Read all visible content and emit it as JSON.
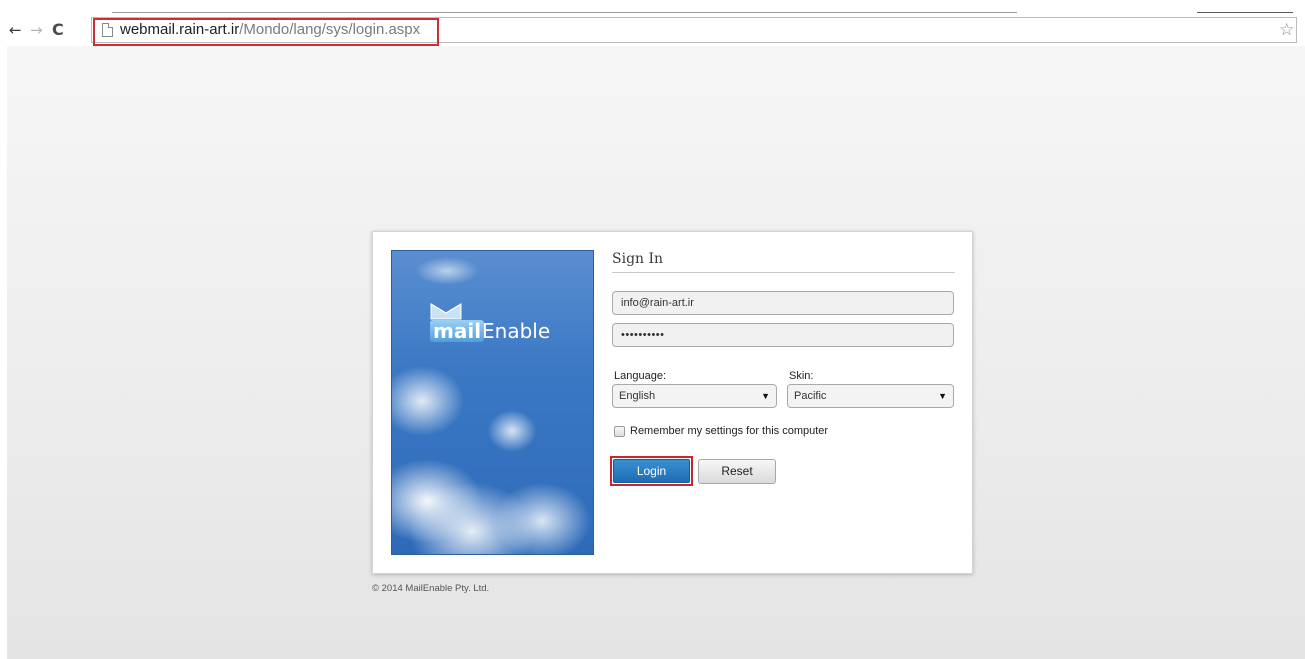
{
  "browser": {
    "back_icon": "arrow-left-icon",
    "forward_icon": "arrow-right-icon",
    "reload_icon": "reload-icon",
    "url_host": "webmail.rain-art.ir",
    "url_path": "/Mondo/lang/sys/login.aspx",
    "bookmark_icon": "star-icon"
  },
  "logo": {
    "mail": "mail",
    "enable": "Enable"
  },
  "signin": {
    "title": "Sign In",
    "email_value": "info@rain-art.ir",
    "password_value": "••••••••••",
    "language_label": "Language:",
    "language_value": "English",
    "skin_label": "Skin:",
    "skin_value": "Pacific",
    "remember_label": "Remember my settings for this computer",
    "login_label": "Login",
    "reset_label": "Reset"
  },
  "footer": {
    "copyright": "© 2014 MailEnable Pty. Ltd."
  },
  "colors": {
    "highlight_red": "#d12c33",
    "login_blue": "#1f6db4"
  }
}
